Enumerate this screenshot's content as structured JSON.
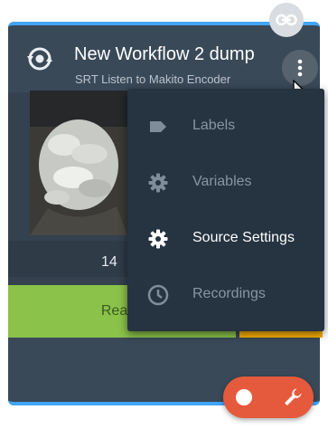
{
  "workflow": {
    "title": "New Workflow 2 dump",
    "subtitle": "SRT Listen to Makito Encoder",
    "count_text": "14",
    "status_label": "Ready"
  },
  "menu": {
    "items": [
      {
        "label": "Labels",
        "icon": "label-icon"
      },
      {
        "label": "Variables",
        "icon": "gear-icon"
      },
      {
        "label": "Source Settings",
        "icon": "gear-icon",
        "active": true
      },
      {
        "label": "Recordings",
        "icon": "clock-icon"
      }
    ]
  },
  "colors": {
    "accent": "#42a5f5",
    "card_bg": "#3a4958",
    "menu_bg": "#263340",
    "ready": "#8bc34a",
    "record": "#ffb300",
    "fab": "#e55a3c"
  },
  "icons": {
    "workflow": "sync-icon",
    "link": "link-icon",
    "more": "more-vert-icon",
    "fab_record": "record-icon",
    "fab_settings": "wrench-icon"
  }
}
